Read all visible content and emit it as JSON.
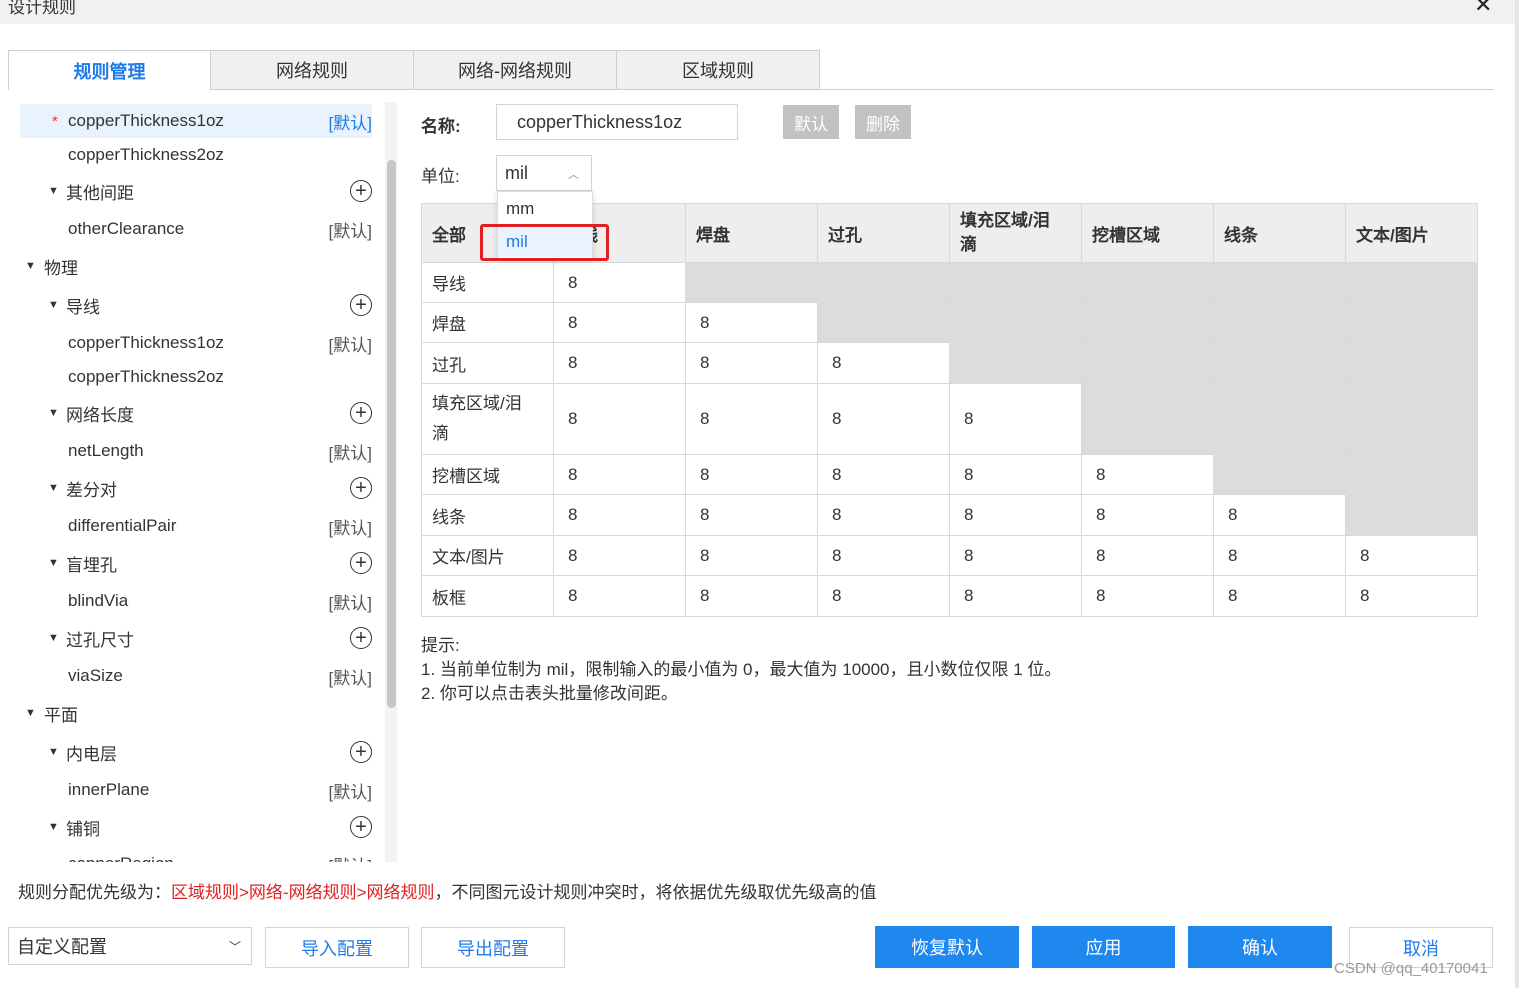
{
  "window": {
    "title": "设计规则",
    "close": "✕"
  },
  "tabs": [
    "规则管理",
    "网络规则",
    "网络-网络规则",
    "区域规则"
  ],
  "tree": {
    "items": [
      {
        "label": "copperThickness1oz",
        "tag": "[默认]",
        "star": "*"
      },
      {
        "label": "copperThickness2oz"
      },
      {
        "label": "其他间距",
        "group": true
      },
      {
        "label": "otherClearance",
        "tag": "[默认]"
      },
      {
        "label": "物理",
        "group": true
      },
      {
        "label": "导线",
        "group": true
      },
      {
        "label": "copperThickness1oz",
        "tag": "[默认]"
      },
      {
        "label": "copperThickness2oz"
      },
      {
        "label": "网络长度",
        "group": true
      },
      {
        "label": "netLength",
        "tag": "[默认]"
      },
      {
        "label": "差分对",
        "group": true
      },
      {
        "label": "differentialPair",
        "tag": "[默认]"
      },
      {
        "label": "盲埋孔",
        "group": true
      },
      {
        "label": "blindVia",
        "tag": "[默认]"
      },
      {
        "label": "过孔尺寸",
        "group": true
      },
      {
        "label": "viaSize",
        "tag": "[默认]"
      },
      {
        "label": "平面",
        "group": true
      },
      {
        "label": "内电层",
        "group": true
      },
      {
        "label": "innerPlane",
        "tag": "[默认]"
      },
      {
        "label": "铺铜",
        "group": true
      },
      {
        "label": "copperRegion",
        "tag": "[默认]"
      }
    ]
  },
  "form": {
    "name_label": "名称:",
    "name_value": "copperThickness1oz",
    "default_btn": "默认",
    "delete_btn": "删除",
    "unit_label": "单位:",
    "unit_value": "mil",
    "unit_options": [
      "mm",
      "mil"
    ]
  },
  "table": {
    "headers": [
      "全部",
      "导线",
      "焊盘",
      "过孔",
      "填充区域/泪滴",
      "挖槽区域",
      "线条",
      "文本/图片"
    ],
    "rows": [
      {
        "label": "导线",
        "values": [
          "8"
        ]
      },
      {
        "label": "焊盘",
        "values": [
          "8",
          "8"
        ]
      },
      {
        "label": "过孔",
        "values": [
          "8",
          "8",
          "8"
        ]
      },
      {
        "label": "填充区域/泪滴",
        "values": [
          "8",
          "8",
          "8",
          "8"
        ]
      },
      {
        "label": "挖槽区域",
        "values": [
          "8",
          "8",
          "8",
          "8",
          "8"
        ]
      },
      {
        "label": "线条",
        "values": [
          "8",
          "8",
          "8",
          "8",
          "8",
          "8"
        ]
      },
      {
        "label": "文本/图片",
        "values": [
          "8",
          "8",
          "8",
          "8",
          "8",
          "8",
          "8"
        ]
      },
      {
        "label": "板框",
        "values": [
          "8",
          "8",
          "8",
          "8",
          "8",
          "8",
          "8"
        ]
      }
    ]
  },
  "hint": {
    "title": "提示:",
    "line1": "1. 当前单位制为 mil，限制输入的最小值为 0，最大值为 10000，且小数位仅限 1 位。",
    "line2": "2. 你可以点击表头批量修改间距。"
  },
  "priority": {
    "prefix": "规则分配优先级为：",
    "order": "区域规则>网络-网络规则>网络规则",
    "suffix": "，不同图元设计规则冲突时，将依据优先级取优先级高的值"
  },
  "footer": {
    "config_value": "自定义配置",
    "import_btn": "导入配置",
    "export_btn": "导出配置",
    "restore_btn": "恢复默认",
    "apply_btn": "应用",
    "confirm_btn": "确认",
    "cancel_btn": "取消"
  },
  "watermark": "CSDN @qq_40170041",
  "colors": {
    "accent": "#1e88ee",
    "highlight": "#e02020",
    "disabled_cell": "#dcdcdc"
  }
}
